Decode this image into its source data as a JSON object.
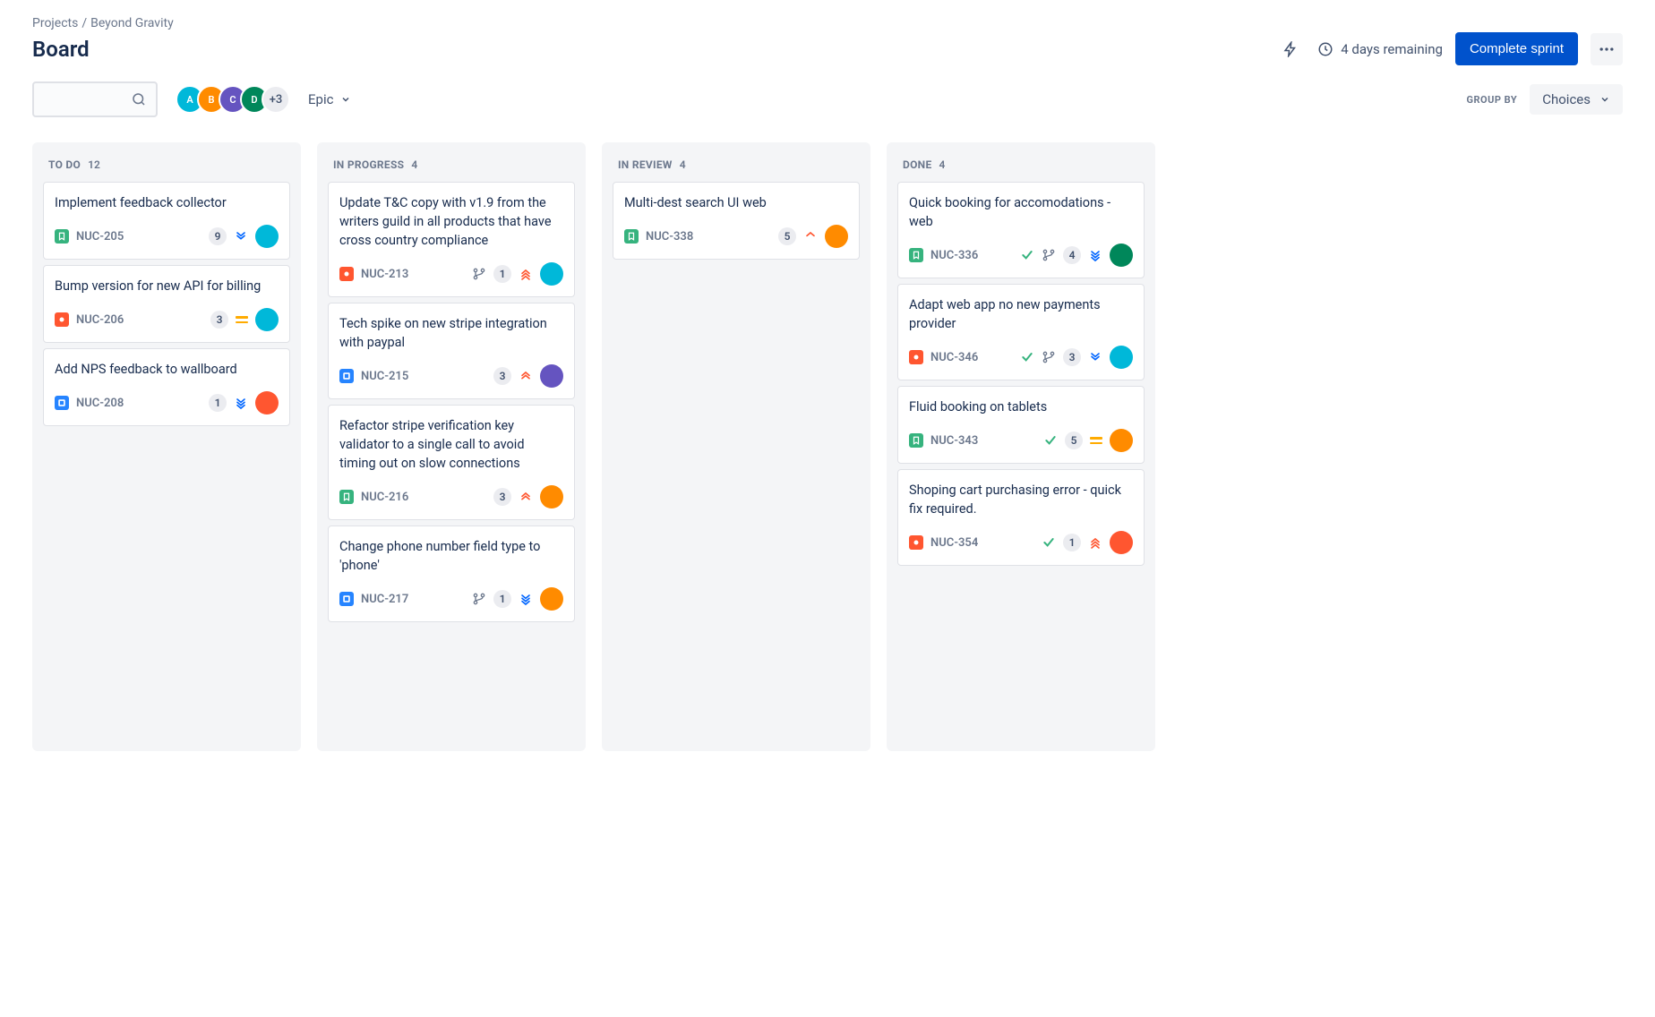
{
  "breadcrumb": {
    "root": "Projects",
    "project": "Beyond Gravity"
  },
  "title": "Board",
  "sprint": {
    "remaining": "4 days remaining",
    "complete_label": "Complete sprint"
  },
  "toolbar": {
    "epic_label": "Epic",
    "group_by_label": "GROUP BY",
    "group_by_value": "Choices",
    "avatar_overflow": "+3",
    "avatars": [
      "A",
      "B",
      "C",
      "D"
    ]
  },
  "avatar_colors": [
    "#00B8D9",
    "#FF8B00",
    "#6554C0",
    "#00875A",
    "#FF5630",
    "#0052CC",
    "#8777D9",
    "#DE350B"
  ],
  "columns": [
    {
      "title": "TO DO",
      "count": "12",
      "cards": [
        {
          "title": "Implement feedback collector",
          "type": "story",
          "key": "NUC-205",
          "count": "9",
          "priority": "low",
          "done": false,
          "branch": false,
          "avatar": 0
        },
        {
          "title": "Bump version for new API for billing",
          "type": "bug",
          "key": "NUC-206",
          "count": "3",
          "priority": "medium",
          "done": false,
          "branch": false,
          "avatar": 0
        },
        {
          "title": "Add NPS feedback to wallboard",
          "type": "task",
          "key": "NUC-208",
          "count": "1",
          "priority": "lowest",
          "done": false,
          "branch": false,
          "avatar": 4
        }
      ]
    },
    {
      "title": "IN PROGRESS",
      "count": "4",
      "cards": [
        {
          "title": "Update T&C copy with v1.9 from the writers guild in all products that have cross country compliance",
          "type": "bug",
          "key": "NUC-213",
          "count": "1",
          "priority": "highest",
          "done": false,
          "branch": true,
          "avatar": 0
        },
        {
          "title": "Tech spike on new stripe integration with paypal",
          "type": "task",
          "key": "NUC-215",
          "count": "3",
          "priority": "high",
          "done": false,
          "branch": false,
          "avatar": 2
        },
        {
          "title": "Refactor stripe verification key validator to a single call to avoid timing out on slow connections",
          "type": "story",
          "key": "NUC-216",
          "count": "3",
          "priority": "high",
          "done": false,
          "branch": false,
          "avatar": 1
        },
        {
          "title": "Change phone number field type to 'phone'",
          "type": "task",
          "key": "NUC-217",
          "count": "1",
          "priority": "lowest",
          "done": false,
          "branch": true,
          "avatar": 1
        }
      ]
    },
    {
      "title": "IN REVIEW",
      "count": "4",
      "cards": [
        {
          "title": "Multi-dest search UI web",
          "type": "story",
          "key": "NUC-338",
          "count": "5",
          "priority": "mediumhigh",
          "done": false,
          "branch": false,
          "avatar": 1
        }
      ]
    },
    {
      "title": "DONE",
      "count": "4",
      "cards": [
        {
          "title": "Quick booking for accomodations - web",
          "type": "story",
          "key": "NUC-336",
          "count": "4",
          "priority": "lowest",
          "done": true,
          "branch": true,
          "avatar": 3
        },
        {
          "title": "Adapt web app no new payments provider",
          "type": "bug",
          "key": "NUC-346",
          "count": "3",
          "priority": "low",
          "done": true,
          "branch": true,
          "avatar": 0
        },
        {
          "title": "Fluid booking on tablets",
          "type": "story",
          "key": "NUC-343",
          "count": "5",
          "priority": "medium",
          "done": true,
          "branch": false,
          "avatar": 1
        },
        {
          "title": "Shoping cart purchasing error - quick fix required.",
          "type": "bug",
          "key": "NUC-354",
          "count": "1",
          "priority": "highest",
          "done": true,
          "branch": false,
          "avatar": 4
        }
      ]
    }
  ]
}
